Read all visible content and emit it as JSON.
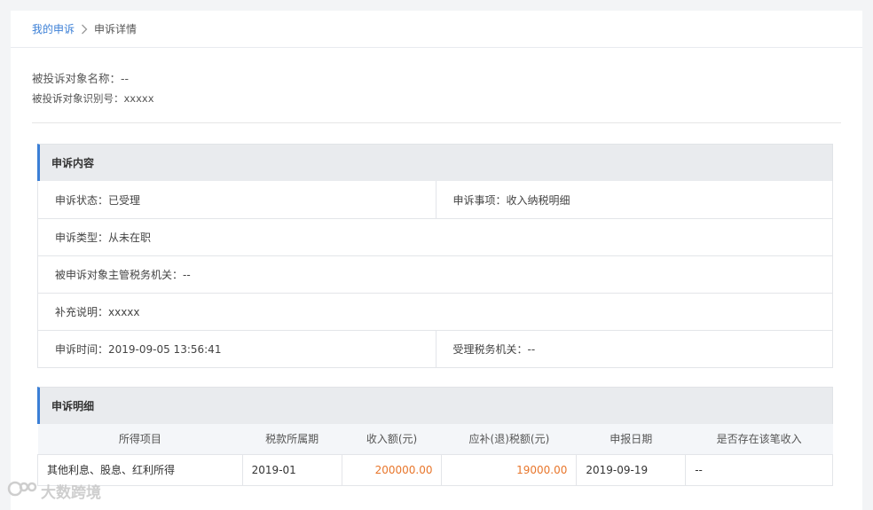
{
  "breadcrumb": {
    "parent": "我的申诉",
    "current": "申诉详情"
  },
  "target": {
    "name_label": "被投诉对象名称：--",
    "id_label": "被投诉对象识别号：xxxxx"
  },
  "appeal_content": {
    "title": "申诉内容",
    "status": "申诉状态：已受理",
    "item": "申诉事项：收入纳税明细",
    "type": "申诉类型：从未在职",
    "tax_authority": "被申诉对象主管税务机关：--",
    "supplement": "补充说明：xxxxx",
    "time": "申诉时间：2019-09-05 13:56:41",
    "accepting_authority": "受理税务机关：--"
  },
  "appeal_detail": {
    "title": "申诉明细",
    "columns": [
      "所得项目",
      "税款所属期",
      "收入额(元)",
      "应补(退)税额(元)",
      "申报日期",
      "是否存在该笔收入"
    ],
    "rows": [
      [
        "其他利息、股息、红利所得",
        "2019-01",
        "200000.00",
        "19000.00",
        "2019-09-19",
        "--"
      ]
    ]
  },
  "watermark": {
    "text": "大数跨境"
  },
  "colors": {
    "accent": "#3b7fd6",
    "amount": "#e8762b",
    "section_bg": "#e9ebee"
  }
}
